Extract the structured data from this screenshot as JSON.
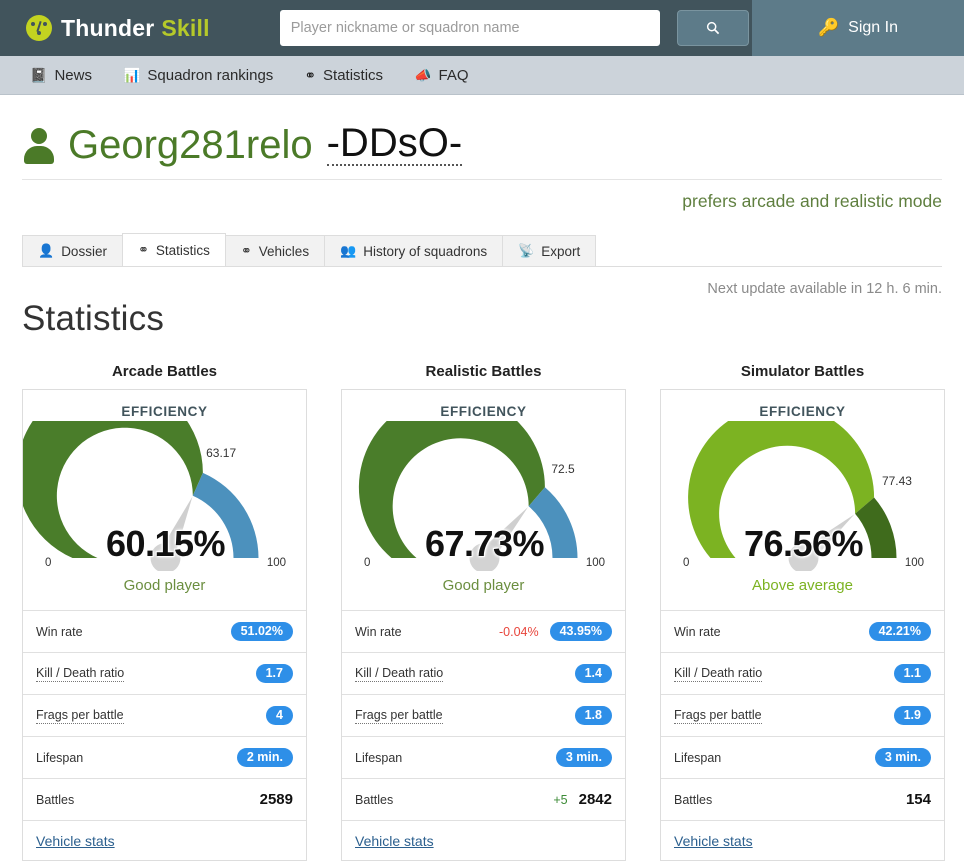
{
  "header": {
    "brand_thunder": "Thunder",
    "brand_skill": "Skill",
    "logo_icon": "gauge-logo-icon",
    "search_placeholder": "Player nickname or squadron name",
    "search_value": "",
    "search_button_icon": "search-icon",
    "signin_label": "Sign In",
    "signin_icon": "key-icon",
    "dark_color": "#41545c",
    "panel_color": "#5d7b89",
    "accent_color": "#b5c92a"
  },
  "nav": {
    "items": [
      {
        "label": "News",
        "icon": "book-icon"
      },
      {
        "label": "Squadron rankings",
        "icon": "bar-chart-icon"
      },
      {
        "label": "Statistics",
        "icon": "gauge-icon"
      },
      {
        "label": "FAQ",
        "icon": "megaphone-icon"
      }
    ]
  },
  "profile": {
    "avatar_icon": "person-icon",
    "nickname": "Georg281relo",
    "squadron": "-DDsO-",
    "prefers": "prefers arcade and realistic mode"
  },
  "tabs": [
    {
      "label": "Dossier",
      "icon": "person-icon",
      "active": false
    },
    {
      "label": "Statistics",
      "icon": "gauge-icon",
      "active": true
    },
    {
      "label": "Vehicles",
      "icon": "gauge-icon",
      "active": false
    },
    {
      "label": "History of squadrons",
      "icon": "group-icon",
      "active": false
    },
    {
      "label": "Export",
      "icon": "rss-icon",
      "active": false
    }
  ],
  "main": {
    "next_update": "Next update available in 12 h. 6 min.",
    "page_title": "Statistics"
  },
  "chart_data": [
    {
      "type": "gauge",
      "title": "Arcade Battles",
      "label": "EFFICIENCY",
      "value": 60.15,
      "value_text": "60.15%",
      "marker_value": 63.17,
      "marker_text": "63.17",
      "min": 0,
      "max": 100,
      "min_label": "0",
      "max_label": "100",
      "arc_color": "#4a7d2a",
      "arc_remainder_color": "#4c91bd",
      "needle_color": "#cfcfcf",
      "rank_text": "Good player",
      "rank_color": "#6b8e3f"
    },
    {
      "type": "gauge",
      "title": "Realistic Battles",
      "label": "EFFICIENCY",
      "value": 67.73,
      "value_text": "67.73%",
      "marker_value": 72.5,
      "marker_text": "72.5",
      "min": 0,
      "max": 100,
      "min_label": "0",
      "max_label": "100",
      "arc_color": "#4a7d2a",
      "arc_remainder_color": "#4c91bd",
      "needle_color": "#cfcfcf",
      "rank_text": "Good player",
      "rank_color": "#6b8e3f"
    },
    {
      "type": "gauge",
      "title": "Simulator Battles",
      "label": "EFFICIENCY",
      "value": 76.56,
      "value_text": "76.56%",
      "marker_value": 77.43,
      "marker_text": "77.43",
      "min": 0,
      "max": 100,
      "min_label": "0",
      "max_label": "100",
      "arc_color": "#7cb322",
      "arc_remainder_color": "#3f6b1c",
      "needle_color": "#cfcfcf",
      "rank_text": "Above average",
      "rank_color": "#7cb322"
    }
  ],
  "cards": [
    {
      "title": "Arcade Battles",
      "stats": [
        {
          "label": "Win rate",
          "dotted": false,
          "delta": "",
          "badge": "51.02%",
          "plain": ""
        },
        {
          "label": "Kill / Death ratio",
          "dotted": true,
          "delta": "",
          "badge": "1.7",
          "plain": ""
        },
        {
          "label": "Frags per battle",
          "dotted": true,
          "delta": "",
          "badge": "4",
          "plain": ""
        },
        {
          "label": "Lifespan",
          "dotted": false,
          "delta": "",
          "badge": "2 min.",
          "plain": ""
        },
        {
          "label": "Battles",
          "dotted": false,
          "delta": "",
          "badge": "",
          "plain": "2589"
        }
      ],
      "link": "Vehicle stats"
    },
    {
      "title": "Realistic Battles",
      "stats": [
        {
          "label": "Win rate",
          "dotted": false,
          "delta": "-0.04%",
          "delta_sign": "neg",
          "badge": "43.95%",
          "plain": ""
        },
        {
          "label": "Kill / Death ratio",
          "dotted": true,
          "delta": "",
          "badge": "1.4",
          "plain": ""
        },
        {
          "label": "Frags per battle",
          "dotted": true,
          "delta": "",
          "badge": "1.8",
          "plain": ""
        },
        {
          "label": "Lifespan",
          "dotted": false,
          "delta": "",
          "badge": "3 min.",
          "plain": ""
        },
        {
          "label": "Battles",
          "dotted": false,
          "delta": "+5",
          "delta_sign": "pos",
          "badge": "",
          "plain": "2842"
        }
      ],
      "link": "Vehicle stats"
    },
    {
      "title": "Simulator Battles",
      "stats": [
        {
          "label": "Win rate",
          "dotted": false,
          "delta": "",
          "badge": "42.21%",
          "plain": ""
        },
        {
          "label": "Kill / Death ratio",
          "dotted": true,
          "delta": "",
          "badge": "1.1",
          "plain": ""
        },
        {
          "label": "Frags per battle",
          "dotted": true,
          "delta": "",
          "badge": "1.9",
          "plain": ""
        },
        {
          "label": "Lifespan",
          "dotted": false,
          "delta": "",
          "badge": "3 min.",
          "plain": ""
        },
        {
          "label": "Battles",
          "dotted": false,
          "delta": "",
          "badge": "",
          "plain": "154"
        }
      ],
      "link": "Vehicle stats"
    }
  ]
}
